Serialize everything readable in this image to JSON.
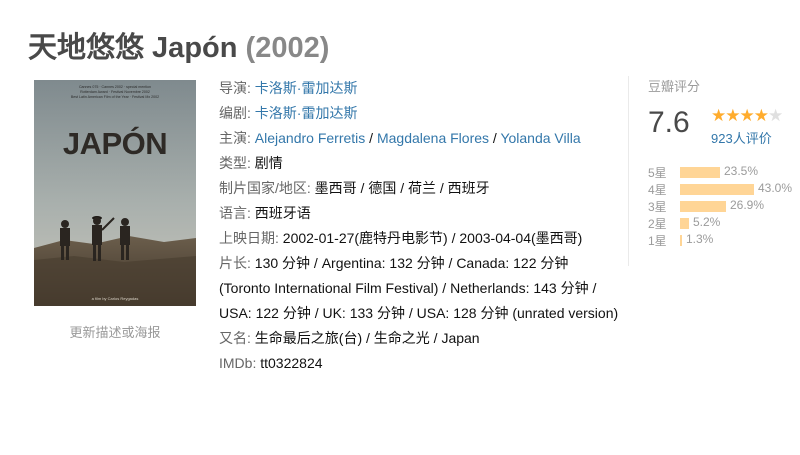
{
  "header": {
    "title": "天地悠悠 Japón",
    "year": "(2002)"
  },
  "poster": {
    "top_text": [
      "Cannes 075 · Cannes 2002 · special mention",
      "Rotterdam Award · Festival Novembre 2002",
      "Best Latin American Film of the Year · Festival Mx 2002"
    ],
    "big_title": "JAPÓN",
    "bottom_text": "a film by Carlos Reygadas",
    "update_link": "更新描述或海报"
  },
  "info": {
    "director_label": "导演: ",
    "director": "卡洛斯·雷加达斯",
    "writer_label": "编剧: ",
    "writer": "卡洛斯·雷加达斯",
    "cast_label": "主演: ",
    "cast": [
      "Alejandro Ferretis",
      "Magdalena Flores",
      "Yolanda Villa"
    ],
    "sep": " / ",
    "genre_label": "类型: ",
    "genre": "剧情",
    "country_label": "制片国家/地区: ",
    "country": "墨西哥 / 德国 / 荷兰 / 西班牙",
    "language_label": "语言: ",
    "language": "西班牙语",
    "release_label": "上映日期: ",
    "release": "2002-01-27(鹿特丹电影节) / 2003-04-04(墨西哥)",
    "runtime_label": "片长: ",
    "runtime": "130 分钟 / Argentina: 132 分钟 / Canada: 122 分钟 (Toronto International Film Festival) / Netherlands: 143 分钟 / USA: 122 分钟 / UK: 133 分钟 / USA: 128 分钟 (unrated version)",
    "aka_label": "又名: ",
    "aka": "生命最后之旅(台) / 生命之光 / Japan",
    "imdb_label": "IMDb: ",
    "imdb": "tt0322824"
  },
  "rating": {
    "label": "豆瓣评分",
    "score": "7.6",
    "stars_filled": "★★★★",
    "stars_empty": "★",
    "votes": "923人评价",
    "distribution": [
      {
        "label": "5星",
        "percent": "23.5%",
        "value": 23.5
      },
      {
        "label": "4星",
        "percent": "43.0%",
        "value": 43.0
      },
      {
        "label": "3星",
        "percent": "26.9%",
        "value": 26.9
      },
      {
        "label": "2星",
        "percent": "5.2%",
        "value": 5.2
      },
      {
        "label": "1星",
        "percent": "1.3%",
        "value": 1.3
      }
    ]
  },
  "colors": {
    "link": "#3377aa",
    "star": "#ffac2d",
    "bar": "#ffd596"
  }
}
